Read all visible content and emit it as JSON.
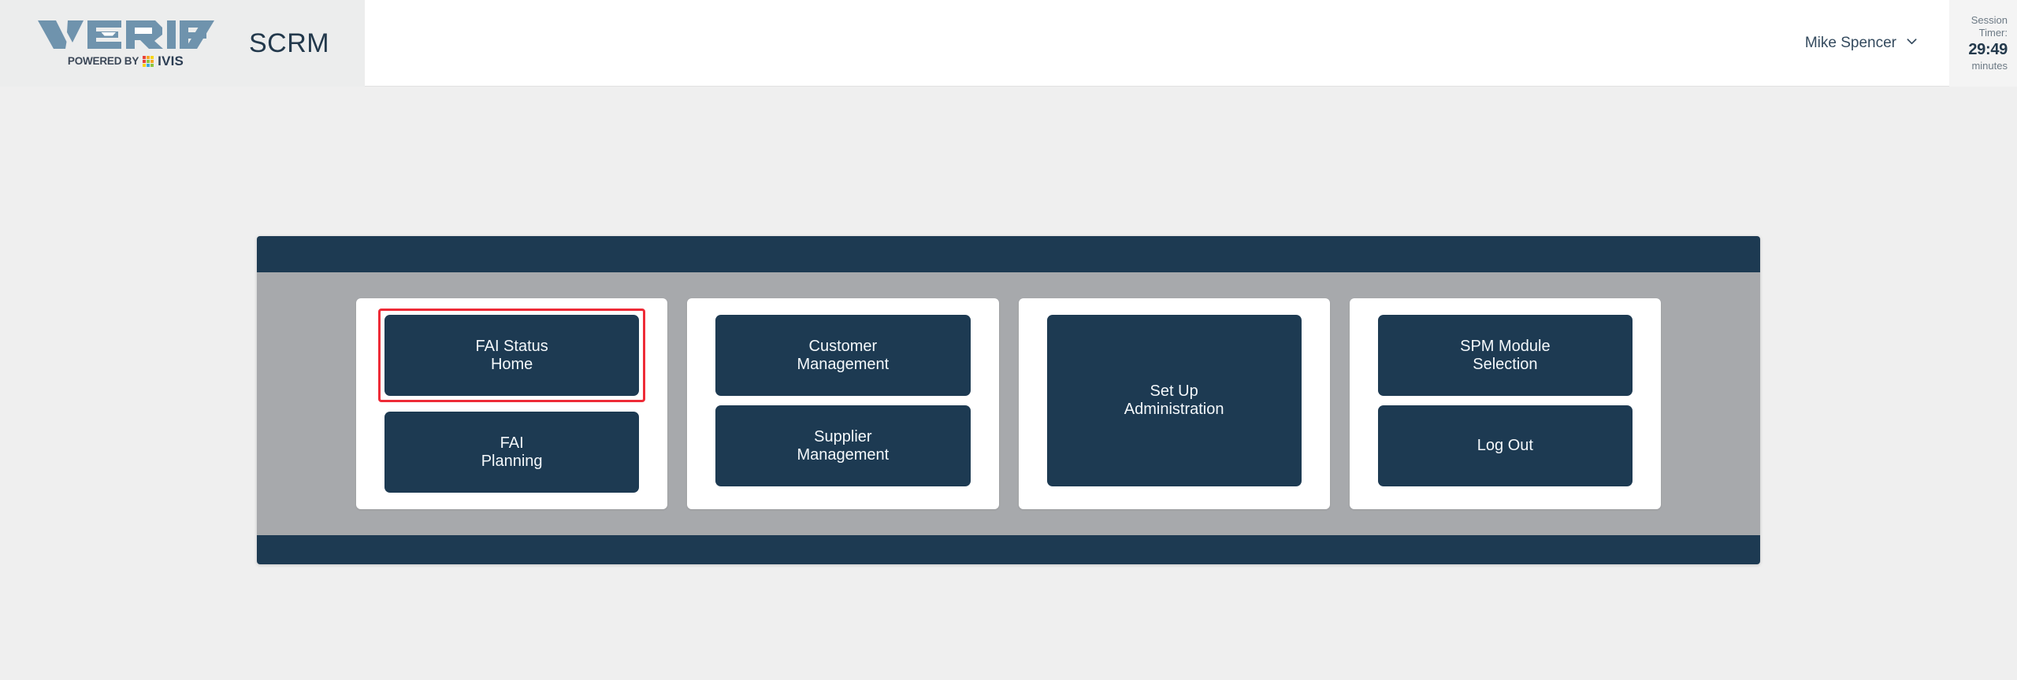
{
  "header": {
    "logo": {
      "wordmark": "VERIFY",
      "tagline": "POWERED BY",
      "brand": "IVIS",
      "grid_icon": "ivis-grid-icon",
      "grid_colors": [
        "#e8423a",
        "#f5a623",
        "#f7d417",
        "#e8423a",
        "#8cc63f",
        "#f5a623",
        "#f7d417",
        "#3ba9e0",
        "#8cc63f"
      ]
    },
    "app_title": "SCRM",
    "user": {
      "name": "Mike Spencer",
      "chevron_icon": "chevron-down-icon"
    },
    "session_timer": {
      "label_line1": "Session",
      "label_line2": "Timer:",
      "value": "29:49",
      "unit": "minutes"
    }
  },
  "main": {
    "cards": [
      {
        "name": "fai-card",
        "tiles": [
          {
            "label": "FAI Status\nHome",
            "name": "fai-status-home-button",
            "highlighted": true,
            "tall": false
          },
          {
            "label": "FAI\nPlanning",
            "name": "fai-planning-button",
            "highlighted": false,
            "tall": false
          }
        ]
      },
      {
        "name": "management-card",
        "tiles": [
          {
            "label": "Customer\nManagement",
            "name": "customer-management-button",
            "highlighted": false,
            "tall": false
          },
          {
            "label": "Supplier\nManagement",
            "name": "supplier-management-button",
            "highlighted": false,
            "tall": false
          }
        ]
      },
      {
        "name": "administration-card",
        "tiles": [
          {
            "label": "Set Up\nAdministration",
            "name": "set-up-administration-button",
            "highlighted": false,
            "tall": true
          }
        ]
      },
      {
        "name": "spm-card",
        "tiles": [
          {
            "label": "SPM Module\nSelection",
            "name": "spm-module-selection-button",
            "highlighted": false,
            "tall": false
          },
          {
            "label": "Log Out",
            "name": "log-out-button",
            "highlighted": false,
            "tall": false
          }
        ]
      }
    ]
  },
  "colors": {
    "navy": "#1d3a52",
    "panel_gray": "#a7a9ac",
    "page_bg": "#efefef",
    "highlight_red": "#ee2b37",
    "logo_blue": "#6f93ad"
  }
}
